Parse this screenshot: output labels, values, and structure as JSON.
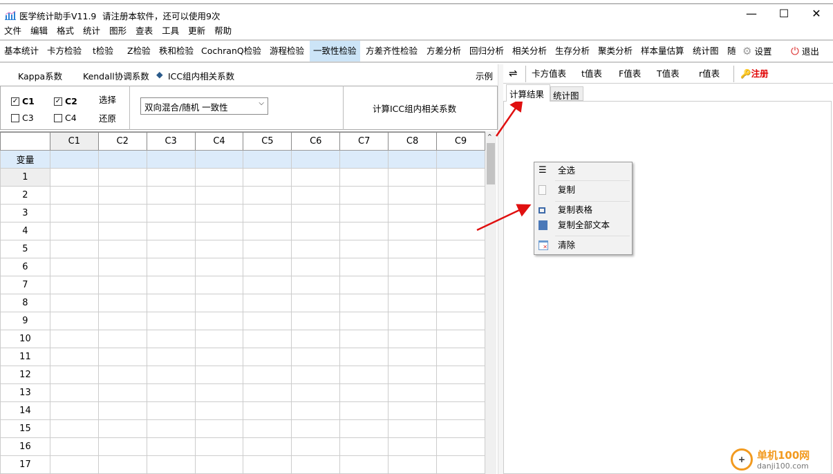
{
  "window": {
    "title": "医学统计助手V11.9",
    "notice": "请注册本软件，还可以使用9次",
    "minimize": "—",
    "maximize": "☐",
    "close": "✕"
  },
  "menu": [
    "文件",
    "编辑",
    "格式",
    "统计",
    "图形",
    "查表",
    "工具",
    "更新",
    "帮助"
  ],
  "toolbar": {
    "items": [
      "基本统计",
      "卡方检验",
      "t检验",
      "Z检验",
      "秩和检验",
      "CochranQ检验",
      "游程检验",
      "一致性检验",
      "方差齐性检验",
      "方差分析",
      "回归分析",
      "相关分析",
      "生存分析",
      "聚类分析",
      "样本量估算",
      "统计图",
      "随"
    ],
    "active": "一致性检验",
    "settings": "设置",
    "exit": "退出"
  },
  "subtabs": {
    "kappa": "Kappa系数",
    "kendall": "Kendall协调系数",
    "icc": "ICC组内相关系数",
    "example": "示例",
    "selected_marker": "◆"
  },
  "controls": {
    "checkboxes": [
      {
        "label": "C1",
        "checked": true
      },
      {
        "label": "C2",
        "checked": true
      },
      {
        "label": "C3",
        "checked": false
      },
      {
        "label": "C4",
        "checked": false
      }
    ],
    "select_btn": "选择",
    "restore_btn": "还原",
    "model_select": "双向混合/随机 一致性",
    "compute_btn": "计算ICC组内相关系数"
  },
  "grid": {
    "columns": [
      "C1",
      "C2",
      "C3",
      "C4",
      "C5",
      "C6",
      "C7",
      "C8",
      "C9"
    ],
    "variable_row": "变量",
    "rows": [
      "1",
      "2",
      "3",
      "4",
      "5",
      "6",
      "7",
      "8",
      "9",
      "10",
      "11",
      "12",
      "13",
      "14",
      "15",
      "16",
      "17"
    ]
  },
  "right": {
    "swap": "⇌",
    "tables": [
      "卡方值表",
      "t值表",
      "F值表",
      "T值表",
      "r值表"
    ],
    "register": "注册",
    "tabs": [
      "计算结果",
      "统计图"
    ],
    "active_tab": "计算结果"
  },
  "context_menu": {
    "items": [
      "全选",
      "复制",
      "复制表格",
      "复制全部文本",
      "清除"
    ]
  },
  "watermark": {
    "name": "单机100网",
    "url": "danji100.com"
  },
  "colors": {
    "active_tab": "#cce4f7",
    "variable_row": "#dcebfa",
    "register": "#e00000",
    "arrow": "#e01010"
  }
}
